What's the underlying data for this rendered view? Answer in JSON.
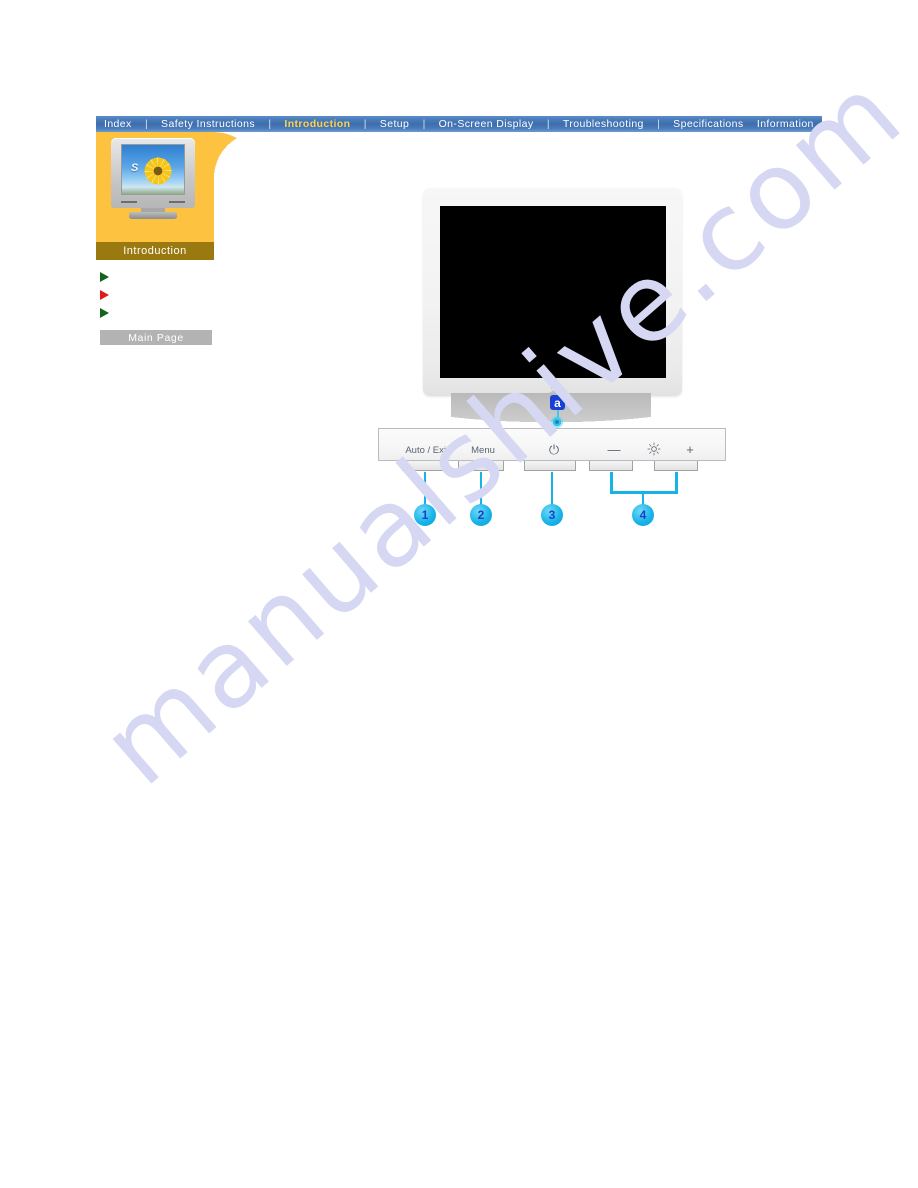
{
  "page": {
    "background": "#ffffff",
    "watermark": "manualshive.com",
    "watermark_color": "#d6d7f2"
  },
  "topnav": {
    "accent_active": "#ffd24a",
    "background": "#4a7dbb",
    "items": [
      {
        "label": "Index",
        "active": false
      },
      {
        "label": "Safety Instructions",
        "active": false
      },
      {
        "label": "Introduction",
        "active": true
      },
      {
        "label": "Setup",
        "active": false
      },
      {
        "label": "On-Screen Display",
        "active": false
      },
      {
        "label": "Troubleshooting",
        "active": false
      },
      {
        "label": "Specifications",
        "active": false
      },
      {
        "label": "Information",
        "active": false
      }
    ],
    "separator": "|"
  },
  "sidebar": {
    "panel_color": "#fcc240",
    "thumbnail": {
      "alt": "monitor-thumbnail",
      "logo_text": "S"
    },
    "label": "Introduction",
    "label_bar_color": "#9a7a10",
    "links": [
      {
        "marker": "green-triangle-icon",
        "color": "#14641e",
        "label": ""
      },
      {
        "marker": "red-triangle-icon",
        "color": "#e01b1b",
        "label": ""
      },
      {
        "marker": "green-triangle-icon",
        "color": "#14641e",
        "label": ""
      }
    ],
    "main_page_button": "Main Page",
    "main_page_button_color": "#b3b3b3"
  },
  "figure": {
    "name": "monitor-front-controls-diagram",
    "screen_color": "#000000",
    "bezel_color": "#f2f2f2",
    "stand_color": "#c6c6c6",
    "indicator": {
      "badge": "a",
      "badge_color": "#1741d6",
      "led_color": "#2fc3ec"
    },
    "controls": [
      {
        "id": "auto-exit",
        "label": "Auto / Exit",
        "type": "text"
      },
      {
        "id": "menu",
        "label": "Menu",
        "type": "text"
      },
      {
        "id": "power",
        "label": "⏻",
        "type": "glyph"
      },
      {
        "id": "minus",
        "label": "—",
        "type": "glyph"
      },
      {
        "id": "brightness",
        "label": "brightness-sun-icon",
        "type": "icon"
      },
      {
        "id": "plus",
        "label": "+",
        "type": "glyph"
      }
    ],
    "callouts": [
      {
        "number": "1",
        "target": "auto-exit"
      },
      {
        "number": "2",
        "target": "menu"
      },
      {
        "number": "3",
        "target": "power"
      },
      {
        "number": "4",
        "target": "minus-plus-bracket"
      }
    ],
    "callout_color": "#16b3e8",
    "callout_number_color": "#1b3fc8"
  }
}
